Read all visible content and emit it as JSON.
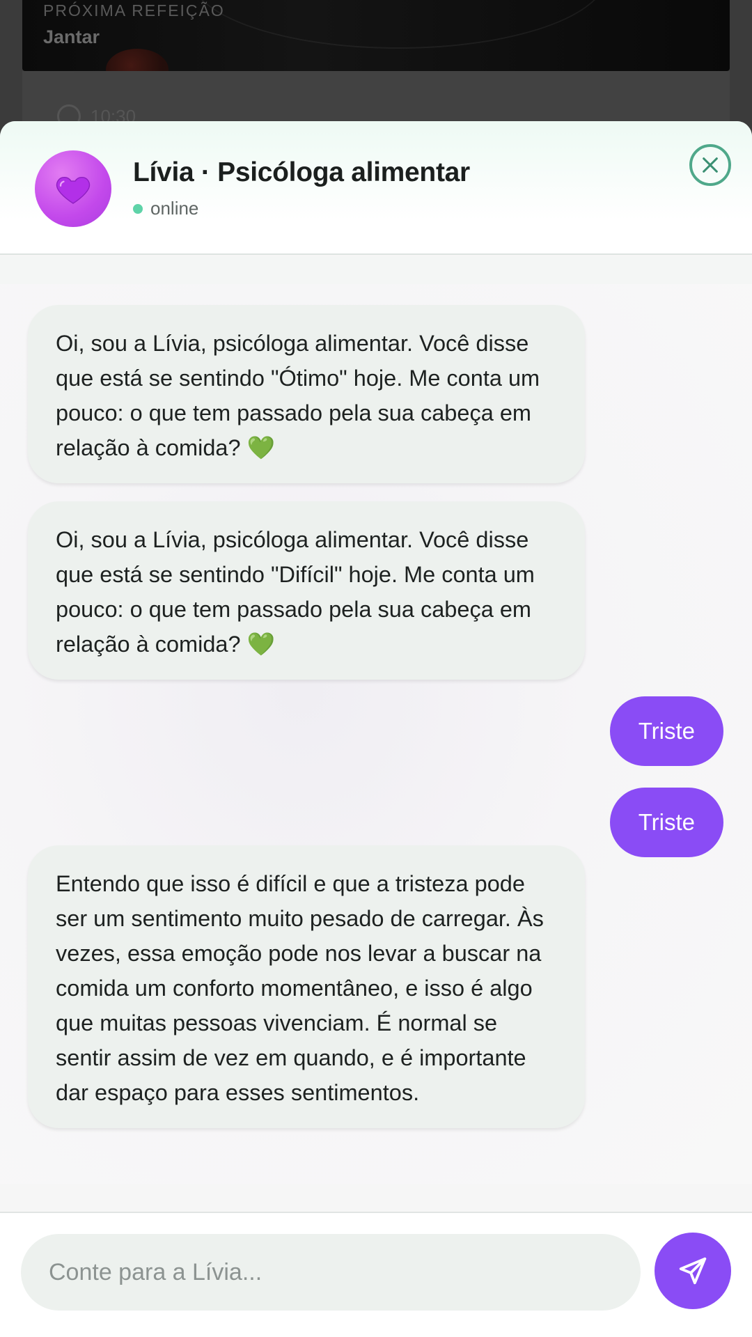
{
  "background": {
    "meal_label": "PRÓXIMA REFEIÇÃO",
    "meal_name": "Jantar",
    "meal_time": "10:30"
  },
  "header": {
    "agent_name": "Lívia · Psicóloga alimentar",
    "status": "online",
    "avatar_icon": "purple-heart-icon",
    "close_icon": "close-icon"
  },
  "messages": [
    {
      "from": "bot",
      "text": "Oi, sou a Lívia, psicóloga alimentar. Você disse que está se sentindo \"Ótimo\" hoje. Me conta um pouco: o que tem passado pela sua cabeça em relação à comida? 💚"
    },
    {
      "from": "bot",
      "text": "Oi, sou a Lívia, psicóloga alimentar. Você disse que está se sentindo \"Difícil\" hoje. Me conta um pouco: o que tem passado pela sua cabeça em relação à comida? 💚"
    },
    {
      "from": "user",
      "text": "Triste"
    },
    {
      "from": "user",
      "text": "Triste"
    },
    {
      "from": "bot",
      "text": "Entendo que isso é difícil e que a tristeza pode ser um sentimento muito pesado de carregar. Às vezes, essa emoção pode nos levar a buscar na comida um conforto momentâneo, e isso é algo que muitas pessoas vivenciam. É normal se sentir assim de vez em quando, e é importante dar espaço para esses sentimentos."
    }
  ],
  "input": {
    "placeholder": "Conte para a Lívia...",
    "value": "",
    "send_icon": "send-icon"
  },
  "colors": {
    "accent": "#8a4cf5",
    "online": "#5ed3a8",
    "close": "#4fa88a",
    "bot_bubble": "#edf1ee"
  }
}
